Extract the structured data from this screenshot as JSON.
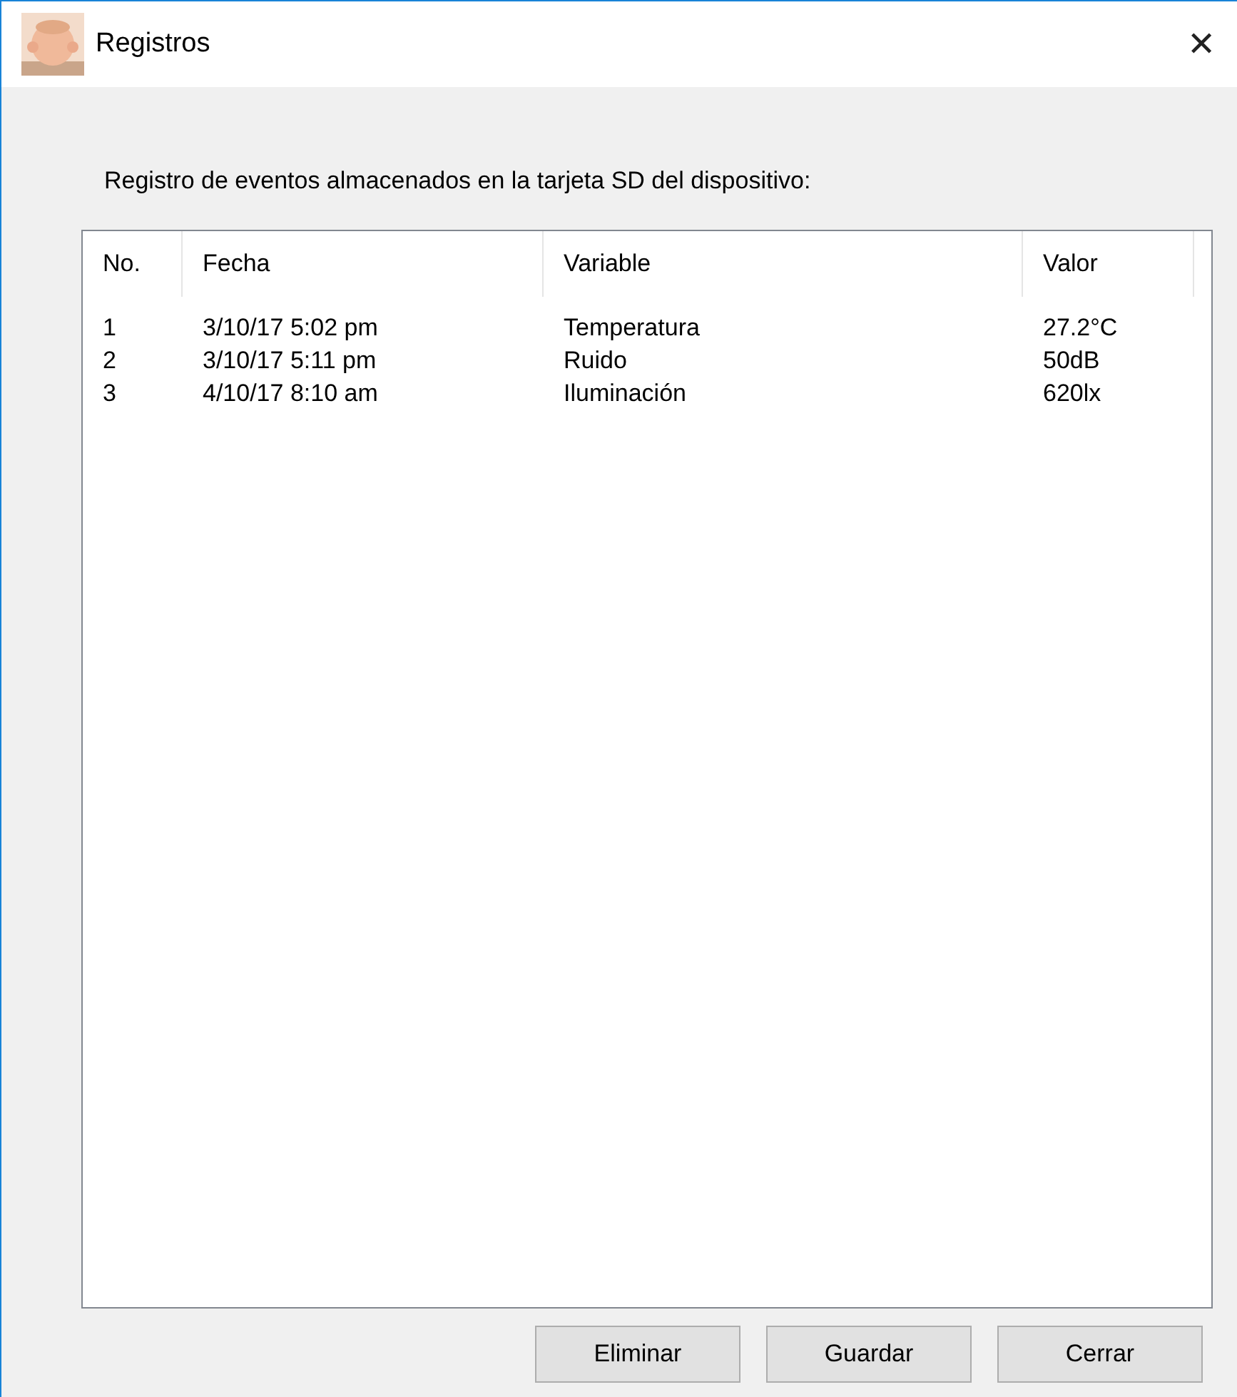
{
  "window": {
    "title": "Registros",
    "close": "✕"
  },
  "description": "Registro de eventos almacenados en la tarjeta SD del dispositivo:",
  "table": {
    "columns": [
      "No.",
      "Fecha",
      "Variable",
      "Valor"
    ],
    "rows": [
      [
        "1",
        "3/10/17 5:02 pm",
        "Temperatura",
        "27.2°C"
      ],
      [
        "2",
        "3/10/17 5:11 pm",
        "Ruido",
        "50dB"
      ],
      [
        "3",
        "4/10/17 8:10 am",
        "Iluminación",
        "620lx"
      ]
    ]
  },
  "buttons": [
    "Eliminar",
    "Guardar",
    "Cerrar"
  ]
}
